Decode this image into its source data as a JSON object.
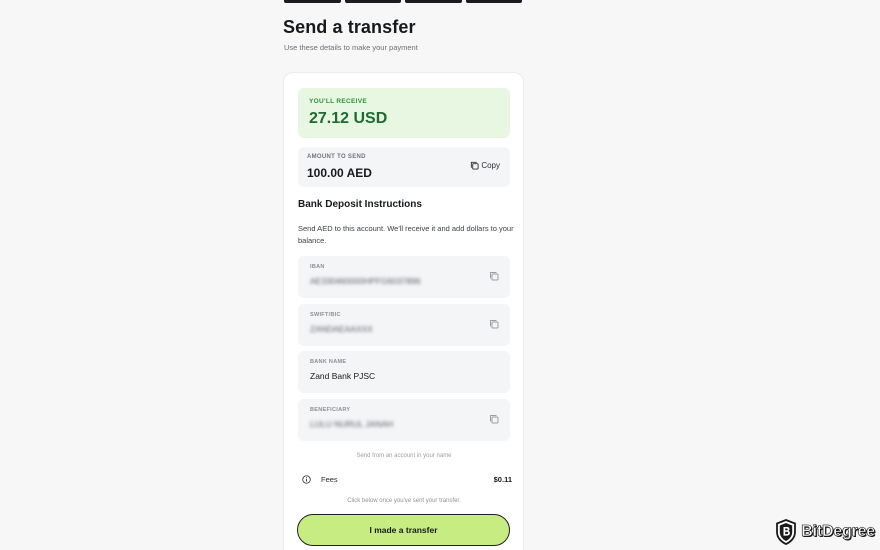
{
  "page": {
    "title": "Send a transfer",
    "subtitle": "Use these details to make your payment"
  },
  "receive": {
    "label": "YOU'LL RECEIVE",
    "value": "27.12 USD"
  },
  "amount": {
    "label": "AMOUNT TO SEND",
    "value": "100.00 AED",
    "copy_label": "Copy"
  },
  "instructions": {
    "title": "Bank Deposit Instructions",
    "text": "Send AED to this account. We'll receive it and add dollars to your balance."
  },
  "fields": {
    "iban": {
      "label": "IBAN",
      "value": "AE330460000HPFG6037896"
    },
    "swift": {
      "label": "SWIFT/BIC",
      "value": "ZANDAEAAXXX"
    },
    "bank": {
      "label": "BANK NAME",
      "value": "Zand Bank PJSC"
    },
    "beneficiary": {
      "label": "BENEFICIARY",
      "value": "LULU NURUL JANAH"
    }
  },
  "notes": {
    "send_from": "Send from an account in your name",
    "click_below": "Click below once you've sent your transfer."
  },
  "fees": {
    "label": "Fees",
    "amount": "$0.11"
  },
  "cta": {
    "label": "I made a transfer"
  },
  "watermark": {
    "text": "BitDegree"
  },
  "icons": {
    "copy": "copy-icon",
    "info": "info-icon",
    "shield": "bitdegree-logo-icon"
  },
  "colors": {
    "accent": "#c7ed82",
    "receive_bg": "#e8f7e1",
    "receive_text": "#1d6b2e"
  }
}
